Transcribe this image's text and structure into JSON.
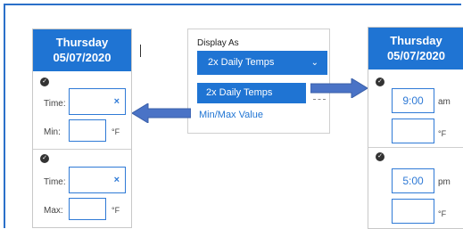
{
  "left_panel": {
    "day": "Thursday",
    "date": "05/07/2020",
    "reading1": {
      "time_label": "Time:",
      "clear_icon": "×",
      "temp_label": "Min:",
      "temp_unit": "°F"
    },
    "reading2": {
      "time_label": "Time:",
      "clear_icon": "×",
      "temp_label": "Max:",
      "temp_unit": "°F"
    }
  },
  "dropdown": {
    "label": "Display As",
    "selected": "2x Daily Temps",
    "options": [
      "2x Daily Temps",
      "Min/Max Value"
    ]
  },
  "right_panel": {
    "day": "Thursday",
    "date": "05/07/2020",
    "reading1": {
      "time": "9:00",
      "period": "am",
      "temp_unit": "°F"
    },
    "reading2": {
      "time": "5:00",
      "period": "pm",
      "temp_unit": "°F"
    }
  },
  "colors": {
    "accent": "#1f74d3",
    "field_border": "#2f7ad6",
    "arrow": "#4a73c6"
  }
}
